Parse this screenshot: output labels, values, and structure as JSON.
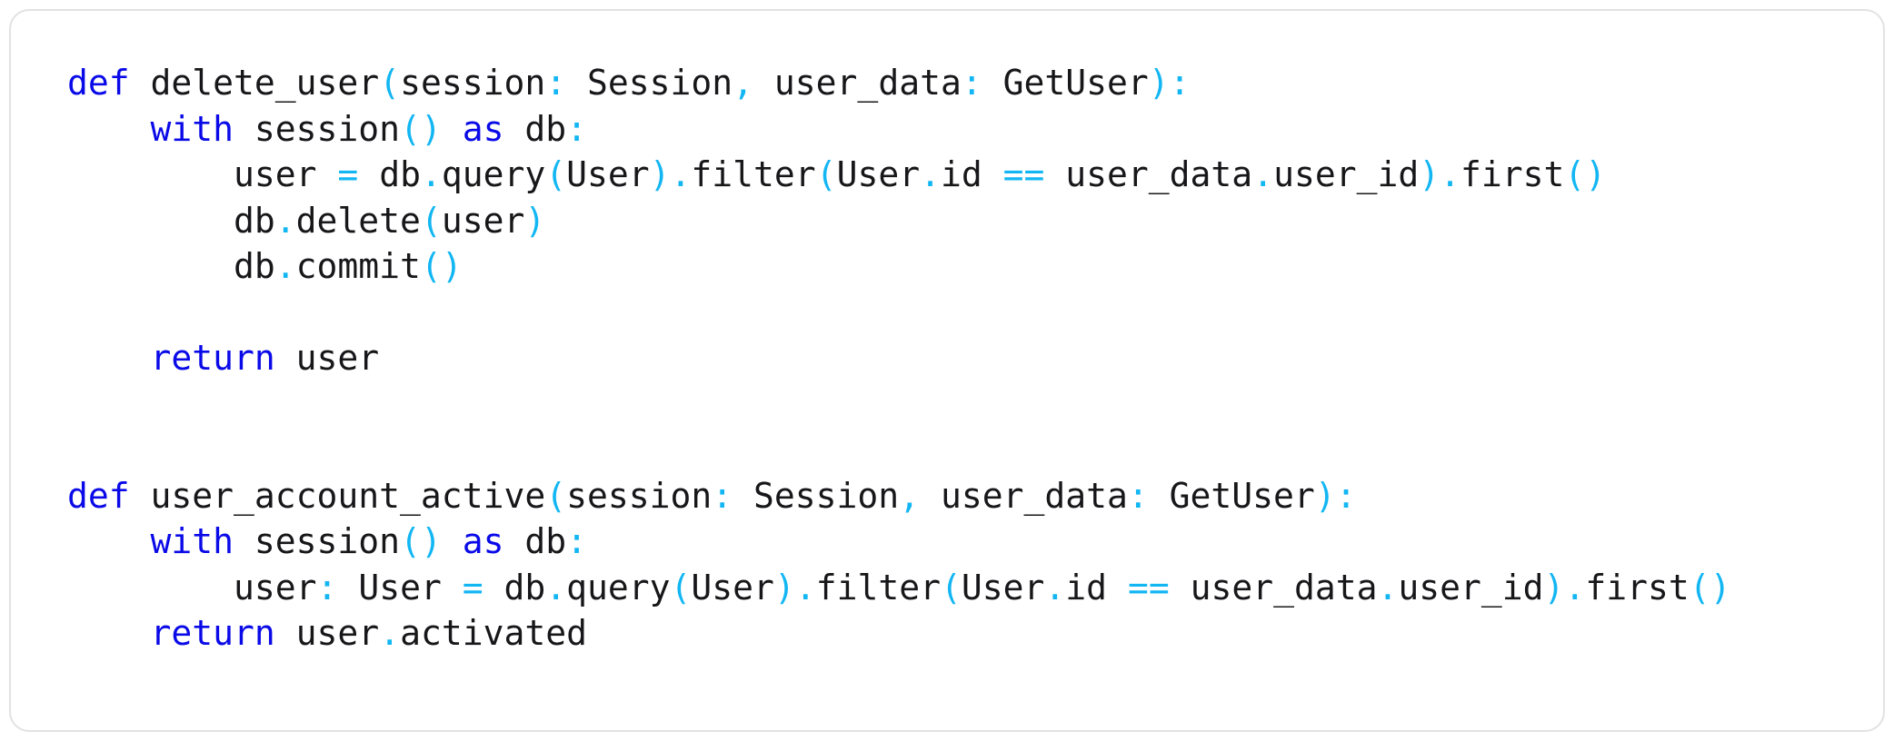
{
  "window": {
    "background_color": "#ffffff",
    "card_border_color": "#e2e2e4",
    "card_background": "#ffffff"
  },
  "theme": {
    "keyword_color": "#0a0ae8",
    "punctuation_color": "#12b6f3",
    "text_color": "#17171a",
    "language": "python"
  },
  "code": {
    "language": "python",
    "full_text": "def delete_user(session: Session, user_data: GetUser):\n    with session() as db:\n        user = db.query(User).filter(User.id == user_data.user_id).first()\n        db.delete(user)\n        db.commit()\n\n    return user\n\n\ndef user_account_active(session: Session, user_data: GetUser):\n    with session() as db:\n        user: User = db.query(User).filter(User.id == user_data.user_id).first()\n    return user.activated",
    "lines": [
      {
        "text": "def delete_user(session: Session, user_data: GetUser):",
        "tokens": [
          {
            "t": "def",
            "c": "kw"
          },
          {
            "t": " delete_user",
            "c": "name"
          },
          {
            "t": "(",
            "c": "punc"
          },
          {
            "t": "session",
            "c": "name"
          },
          {
            "t": ":",
            "c": "punc"
          },
          {
            "t": " Session",
            "c": "name"
          },
          {
            "t": ",",
            "c": "punc"
          },
          {
            "t": " user_data",
            "c": "name"
          },
          {
            "t": ":",
            "c": "punc"
          },
          {
            "t": " GetUser",
            "c": "name"
          },
          {
            "t": ")",
            "c": "punc"
          },
          {
            "t": ":",
            "c": "punc"
          }
        ]
      },
      {
        "text": "    with session() as db:",
        "tokens": [
          {
            "t": "    ",
            "c": "plain"
          },
          {
            "t": "with",
            "c": "kw"
          },
          {
            "t": " session",
            "c": "name"
          },
          {
            "t": "()",
            "c": "punc"
          },
          {
            "t": " ",
            "c": "plain"
          },
          {
            "t": "as",
            "c": "kw"
          },
          {
            "t": " db",
            "c": "name"
          },
          {
            "t": ":",
            "c": "punc"
          }
        ]
      },
      {
        "text": "        user = db.query(User).filter(User.id == user_data.user_id).first()",
        "tokens": [
          {
            "t": "        user ",
            "c": "name"
          },
          {
            "t": "=",
            "c": "punc"
          },
          {
            "t": " db",
            "c": "name"
          },
          {
            "t": ".",
            "c": "punc"
          },
          {
            "t": "query",
            "c": "name"
          },
          {
            "t": "(",
            "c": "punc"
          },
          {
            "t": "User",
            "c": "name"
          },
          {
            "t": ")",
            "c": "punc"
          },
          {
            "t": ".",
            "c": "punc"
          },
          {
            "t": "filter",
            "c": "name"
          },
          {
            "t": "(",
            "c": "punc"
          },
          {
            "t": "User",
            "c": "name"
          },
          {
            "t": ".",
            "c": "punc"
          },
          {
            "t": "id ",
            "c": "name"
          },
          {
            "t": "==",
            "c": "punc"
          },
          {
            "t": " user_data",
            "c": "name"
          },
          {
            "t": ".",
            "c": "punc"
          },
          {
            "t": "user_id",
            "c": "name"
          },
          {
            "t": ")",
            "c": "punc"
          },
          {
            "t": ".",
            "c": "punc"
          },
          {
            "t": "first",
            "c": "name"
          },
          {
            "t": "()",
            "c": "punc"
          }
        ]
      },
      {
        "text": "        db.delete(user)",
        "tokens": [
          {
            "t": "        db",
            "c": "name"
          },
          {
            "t": ".",
            "c": "punc"
          },
          {
            "t": "delete",
            "c": "name"
          },
          {
            "t": "(",
            "c": "punc"
          },
          {
            "t": "user",
            "c": "name"
          },
          {
            "t": ")",
            "c": "punc"
          }
        ]
      },
      {
        "text": "        db.commit()",
        "tokens": [
          {
            "t": "        db",
            "c": "name"
          },
          {
            "t": ".",
            "c": "punc"
          },
          {
            "t": "commit",
            "c": "name"
          },
          {
            "t": "()",
            "c": "punc"
          }
        ]
      },
      {
        "text": "",
        "tokens": []
      },
      {
        "text": "    return user",
        "tokens": [
          {
            "t": "    ",
            "c": "plain"
          },
          {
            "t": "return",
            "c": "kw"
          },
          {
            "t": " user",
            "c": "name"
          }
        ]
      },
      {
        "text": "",
        "tokens": []
      },
      {
        "text": "",
        "tokens": []
      },
      {
        "text": "def user_account_active(session: Session, user_data: GetUser):",
        "tokens": [
          {
            "t": "def",
            "c": "kw"
          },
          {
            "t": " user_account_active",
            "c": "name"
          },
          {
            "t": "(",
            "c": "punc"
          },
          {
            "t": "session",
            "c": "name"
          },
          {
            "t": ":",
            "c": "punc"
          },
          {
            "t": " Session",
            "c": "name"
          },
          {
            "t": ",",
            "c": "punc"
          },
          {
            "t": " user_data",
            "c": "name"
          },
          {
            "t": ":",
            "c": "punc"
          },
          {
            "t": " GetUser",
            "c": "name"
          },
          {
            "t": ")",
            "c": "punc"
          },
          {
            "t": ":",
            "c": "punc"
          }
        ]
      },
      {
        "text": "    with session() as db:",
        "tokens": [
          {
            "t": "    ",
            "c": "plain"
          },
          {
            "t": "with",
            "c": "kw"
          },
          {
            "t": " session",
            "c": "name"
          },
          {
            "t": "()",
            "c": "punc"
          },
          {
            "t": " ",
            "c": "plain"
          },
          {
            "t": "as",
            "c": "kw"
          },
          {
            "t": " db",
            "c": "name"
          },
          {
            "t": ":",
            "c": "punc"
          }
        ]
      },
      {
        "text": "        user: User = db.query(User).filter(User.id == user_data.user_id).first()",
        "tokens": [
          {
            "t": "        user",
            "c": "name"
          },
          {
            "t": ":",
            "c": "punc"
          },
          {
            "t": " User ",
            "c": "name"
          },
          {
            "t": "=",
            "c": "punc"
          },
          {
            "t": " db",
            "c": "name"
          },
          {
            "t": ".",
            "c": "punc"
          },
          {
            "t": "query",
            "c": "name"
          },
          {
            "t": "(",
            "c": "punc"
          },
          {
            "t": "User",
            "c": "name"
          },
          {
            "t": ")",
            "c": "punc"
          },
          {
            "t": ".",
            "c": "punc"
          },
          {
            "t": "filter",
            "c": "name"
          },
          {
            "t": "(",
            "c": "punc"
          },
          {
            "t": "User",
            "c": "name"
          },
          {
            "t": ".",
            "c": "punc"
          },
          {
            "t": "id ",
            "c": "name"
          },
          {
            "t": "==",
            "c": "punc"
          },
          {
            "t": " user_data",
            "c": "name"
          },
          {
            "t": ".",
            "c": "punc"
          },
          {
            "t": "user_id",
            "c": "name"
          },
          {
            "t": ")",
            "c": "punc"
          },
          {
            "t": ".",
            "c": "punc"
          },
          {
            "t": "first",
            "c": "name"
          },
          {
            "t": "()",
            "c": "punc"
          }
        ]
      },
      {
        "text": "    return user.activated",
        "tokens": [
          {
            "t": "    ",
            "c": "plain"
          },
          {
            "t": "return",
            "c": "kw"
          },
          {
            "t": " user",
            "c": "name"
          },
          {
            "t": ".",
            "c": "punc"
          },
          {
            "t": "activated",
            "c": "name"
          }
        ]
      }
    ]
  }
}
